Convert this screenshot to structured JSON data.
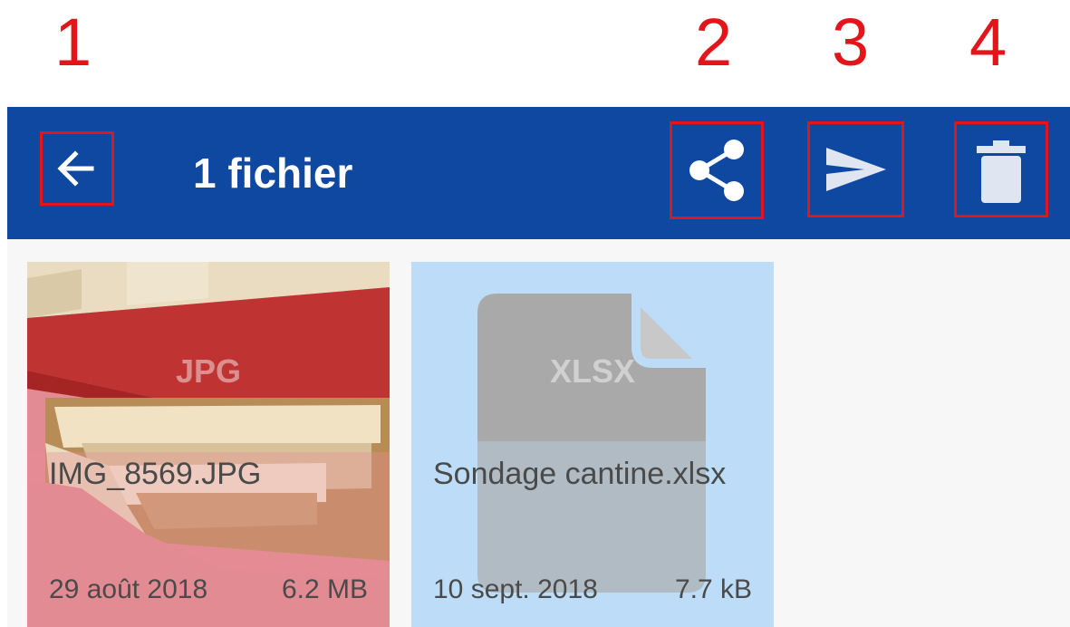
{
  "callouts": [
    "1",
    "2",
    "3",
    "4"
  ],
  "appbar": {
    "title": "1 fichier",
    "background": "#0e48a1",
    "actions": [
      {
        "name": "back",
        "icon": "arrow-left-icon"
      },
      {
        "name": "share",
        "icon": "share-icon"
      },
      {
        "name": "send",
        "icon": "send-icon"
      },
      {
        "name": "delete",
        "icon": "trash-icon"
      }
    ]
  },
  "files": [
    {
      "type": "JPG",
      "name": "IMG_8569.JPG",
      "date": "29 août 2018",
      "size": "6.2 MB",
      "selected": false
    },
    {
      "type": "XLSX",
      "name": "Sondage cantine.xlsx",
      "date": "10 sept. 2018",
      "size": "7.7 kB",
      "selected": true
    }
  ],
  "colors": {
    "accent": "#0e48a1",
    "highlight": "#e3151b",
    "selection": "#bcdcf7"
  }
}
